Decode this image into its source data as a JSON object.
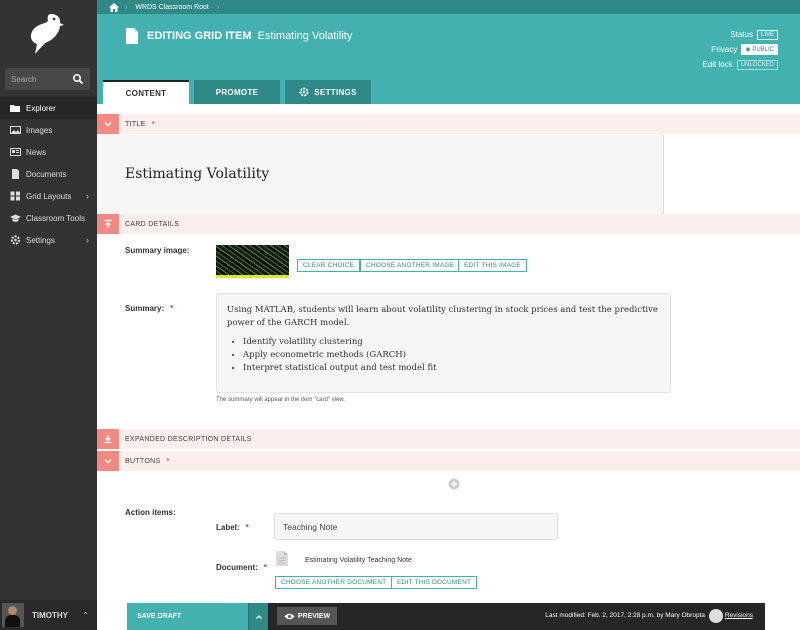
{
  "search": {
    "placeholder": "Search"
  },
  "sidebar": {
    "items": [
      {
        "label": "Explorer",
        "icon": "folder-open-icon"
      },
      {
        "label": "Images",
        "icon": "image-icon"
      },
      {
        "label": "News",
        "icon": "newspaper-icon"
      },
      {
        "label": "Documents",
        "icon": "document-icon"
      },
      {
        "label": "Grid Layouts",
        "icon": "grid-icon"
      },
      {
        "label": "Classroom Tools",
        "icon": "graduation-cap-icon"
      },
      {
        "label": "Settings",
        "icon": "cog-icon"
      }
    ],
    "user": "TIMOTHY"
  },
  "breadcrumb": {
    "item": "WRDS Classroom Root"
  },
  "header": {
    "editing_label": "EDITING GRID ITEM",
    "page_name": "Estimating Volatility",
    "status_label": "Status",
    "status_value": "LIVE",
    "privacy_label": "Privacy",
    "privacy_value": "PUBLIC",
    "editlock_label": "Edit lock",
    "editlock_value": "UNLOCKED"
  },
  "tabs": {
    "content": "CONTENT",
    "promote": "PROMOTE",
    "settings": "SETTINGS"
  },
  "sections": {
    "title": "TITLE",
    "card_details": "CARD DETAILS",
    "expanded": "EXPANDED DESCRIPTION DETAILS",
    "buttons": "BUTTONS",
    "required_mark": "*"
  },
  "title_value": "Estimating Volatility",
  "card": {
    "summary_image_label": "Summary image:",
    "clear_choice": "CLEAR CHOICE",
    "choose_another_image": "CHOOSE ANOTHER IMAGE",
    "edit_this_image": "EDIT THIS IMAGE",
    "summary_label": "Summary:",
    "summary_text": "Using MATLAB, students will learn about volatility clustering in stock prices and test the predictive power of the GARCH model.",
    "bullets": [
      "Identify volatility clustering",
      "Apply econometric methods (GARCH)",
      "Interpret statistical output and test model fit"
    ],
    "hint": "The summary will appear in the item \"card\" view."
  },
  "buttons": {
    "action_items_label": "Action items:",
    "label_label": "Label:",
    "label_value": "Teaching Note",
    "document_label": "Document:",
    "document_name": "Estimating Volatility Teaching Note",
    "choose_another_document": "CHOOSE ANOTHER DOCUMENT",
    "edit_this_document": "EDIT THIS DOCUMENT"
  },
  "footer": {
    "save_draft": "SAVE DRAFT",
    "preview": "PREVIEW",
    "last_modified": "Last modified: Feb. 2, 2017, 2:28 p.m. by Mary Obropta",
    "revisions": "Revisions"
  },
  "colors": {
    "teal": "#43b1b0",
    "dark_teal": "#2f8986",
    "sidebar": "#333333",
    "section_pink": "#fceeed",
    "section_red": "#f28a84"
  }
}
